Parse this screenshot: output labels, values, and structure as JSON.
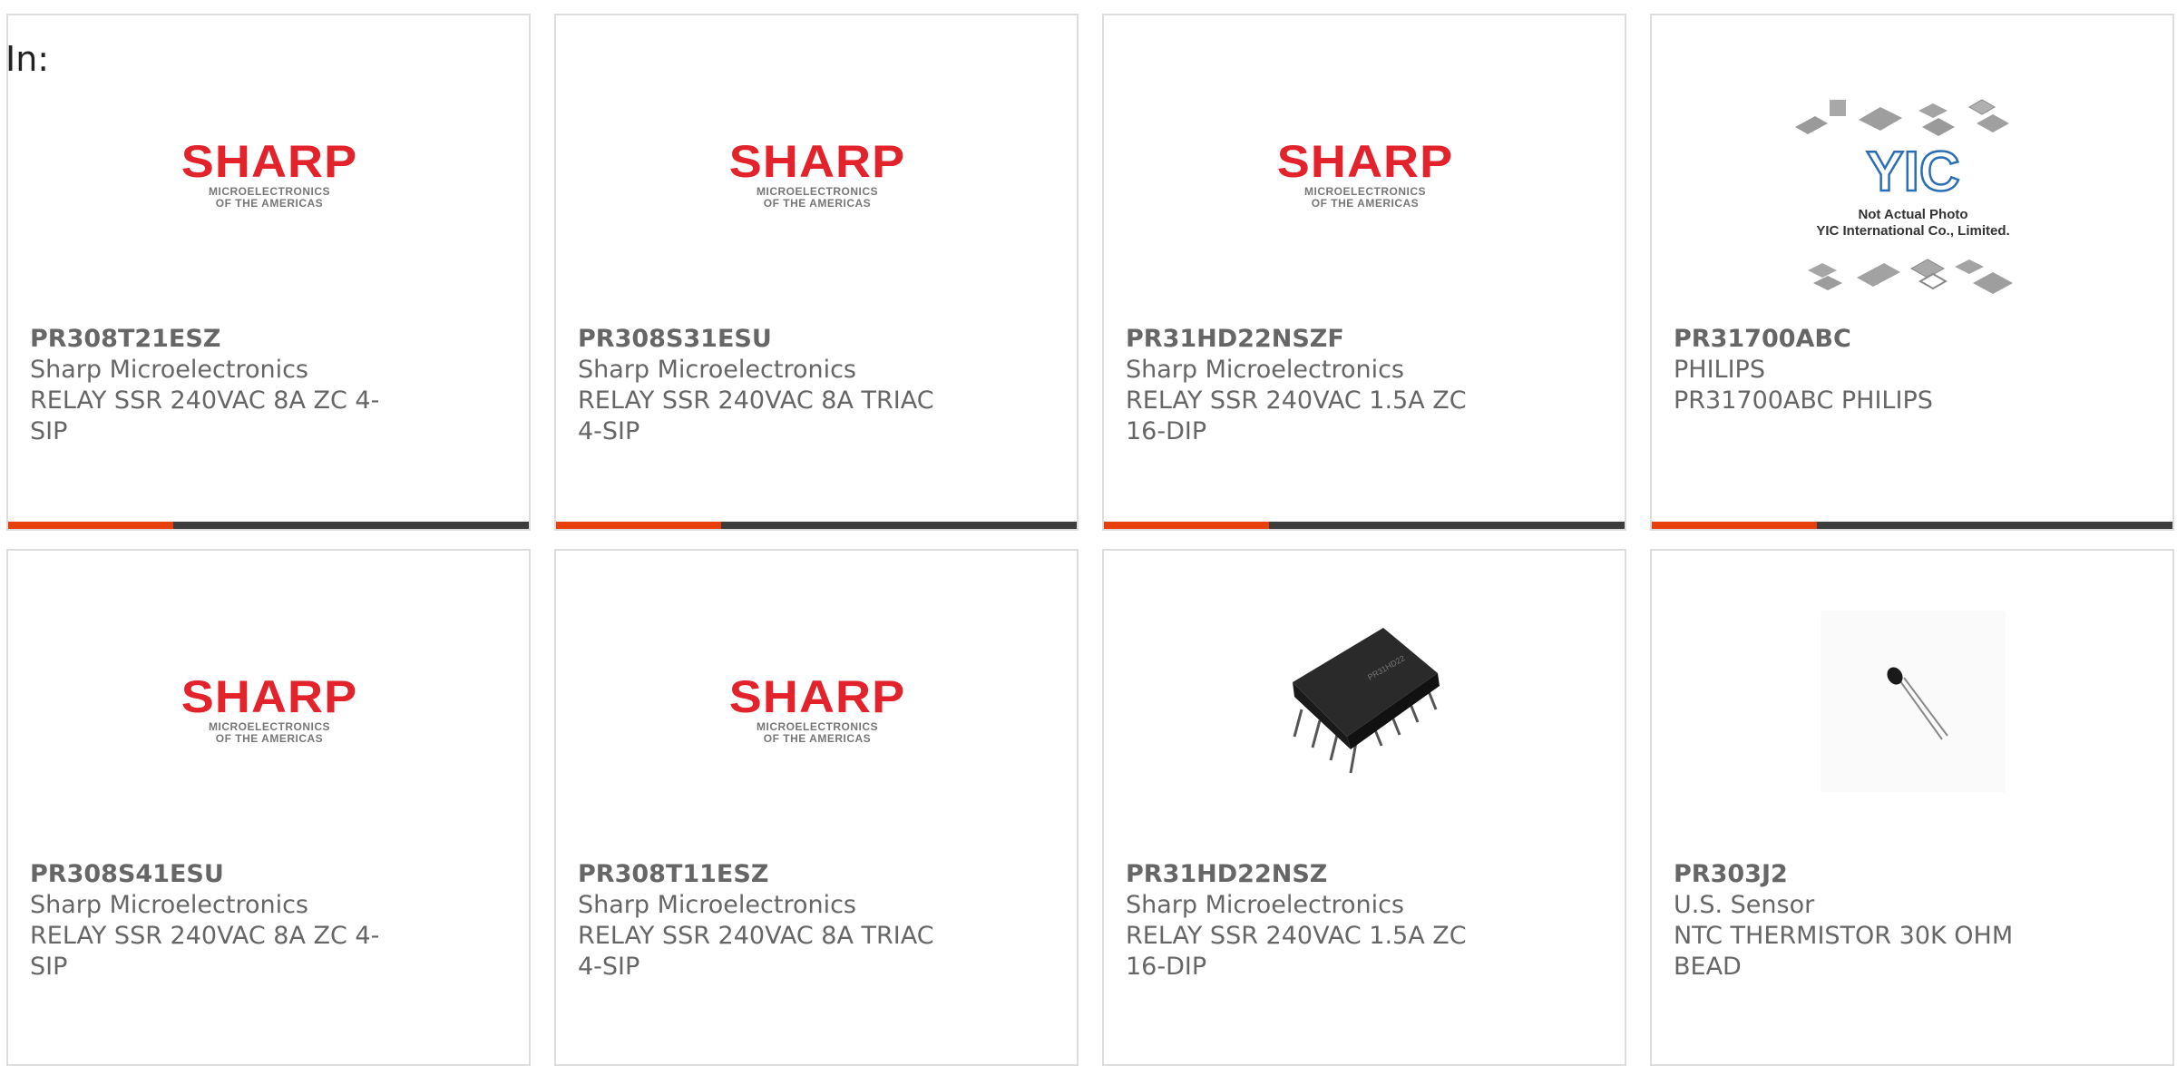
{
  "filter": {
    "label": "In:"
  },
  "products": [
    {
      "part": "PR308T21ESZ",
      "manufacturer": "Sharp Microelectronics",
      "description": "RELAY SSR 240VAC 8A ZC 4-SIP",
      "image": "sharp-logo"
    },
    {
      "part": "PR308S31ESU",
      "manufacturer": "Sharp Microelectronics",
      "description": "RELAY SSR 240VAC 8A TRIAC 4-SIP",
      "image": "sharp-logo"
    },
    {
      "part": "PR31HD22NSZF",
      "manufacturer": "Sharp Microelectronics",
      "description": "RELAY SSR 240VAC 1.5A ZC 16-DIP",
      "image": "sharp-logo"
    },
    {
      "part": "PR31700ABC",
      "manufacturer": "PHILIPS",
      "description": "PR31700ABC PHILIPS",
      "image": "yic-not-actual-photo"
    },
    {
      "part": "PR308S41ESU",
      "manufacturer": "Sharp Microelectronics",
      "description": "RELAY SSR 240VAC 8A ZC 4-SIP",
      "image": "sharp-logo"
    },
    {
      "part": "PR308T11ESZ",
      "manufacturer": "Sharp Microelectronics",
      "description": "RELAY SSR 240VAC 8A TRIAC 4-SIP",
      "image": "sharp-logo"
    },
    {
      "part": "PR31HD22NSZ",
      "manufacturer": "Sharp Microelectronics",
      "description": "RELAY SSR 240VAC 1.5A ZC 16-DIP",
      "image": "dip-chip-photo"
    },
    {
      "part": "PR303J2",
      "manufacturer": "U.S. Sensor",
      "description": "NTC THERMISTOR 30K OHM BEAD",
      "image": "thermistor-photo"
    }
  ],
  "logos": {
    "sharp": {
      "word": "SHARP",
      "sub_line1": "MICROELECTRONICS",
      "sub_line2": "OF THE AMERICAS"
    },
    "yic": {
      "mark": "YIC",
      "caption_line1": "Not Actual Photo",
      "caption_line2": "YIC International Co., Limited."
    }
  },
  "colors": {
    "accent": "#e8400d",
    "bar": "#3d3d3d",
    "sharp_red": "#e3232b",
    "text": "#666666",
    "border": "#dddddd"
  }
}
